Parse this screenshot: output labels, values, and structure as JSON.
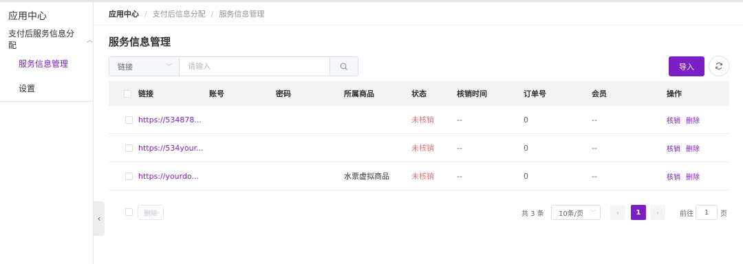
{
  "sidebar": {
    "title": "应用中心",
    "group_label": "支付后服务信息分配",
    "items": [
      {
        "label": "服务信息管理"
      },
      {
        "label": "设置"
      }
    ]
  },
  "breadcrumb": {
    "root": "应用中心",
    "level2": "支付后信息分配",
    "level3": "服务信息管理",
    "separator": "/"
  },
  "page_title": "服务信息管理",
  "search": {
    "field_selected": "链接",
    "placeholder": "请输入"
  },
  "toolbar": {
    "import_label": "导入"
  },
  "table": {
    "columns": [
      "链接",
      "账号",
      "密码",
      "所属商品",
      "状态",
      "核销时间",
      "订单号",
      "会员",
      "操作"
    ],
    "rows": [
      {
        "link": "https://534878...",
        "account": "",
        "password": "",
        "product": "",
        "status": "未核销",
        "verify_time": "--",
        "order_no": "0",
        "member": "--",
        "op_verify": "核销",
        "op_delete": "删除"
      },
      {
        "link": "https://534your...",
        "account": "",
        "password": "",
        "product": "",
        "status": "未核销",
        "verify_time": "--",
        "order_no": "0",
        "member": "--",
        "op_verify": "核销",
        "op_delete": "删除"
      },
      {
        "link": "https://yourdo...",
        "account": "",
        "password": "",
        "product": "水票虚拟商品",
        "status": "未核销",
        "verify_time": "--",
        "order_no": "0",
        "member": "--",
        "op_verify": "核销",
        "op_delete": "删除"
      }
    ]
  },
  "footer": {
    "delete_label": "删除"
  },
  "pagination": {
    "total_text": "共 3 条",
    "page_size": "10条/页",
    "current_page": "1",
    "goto_label": "前往",
    "goto_value": "1",
    "page_suffix": "页"
  },
  "colors": {
    "accent": "#7c1fc4",
    "status_unverified": "#f56c6c"
  }
}
